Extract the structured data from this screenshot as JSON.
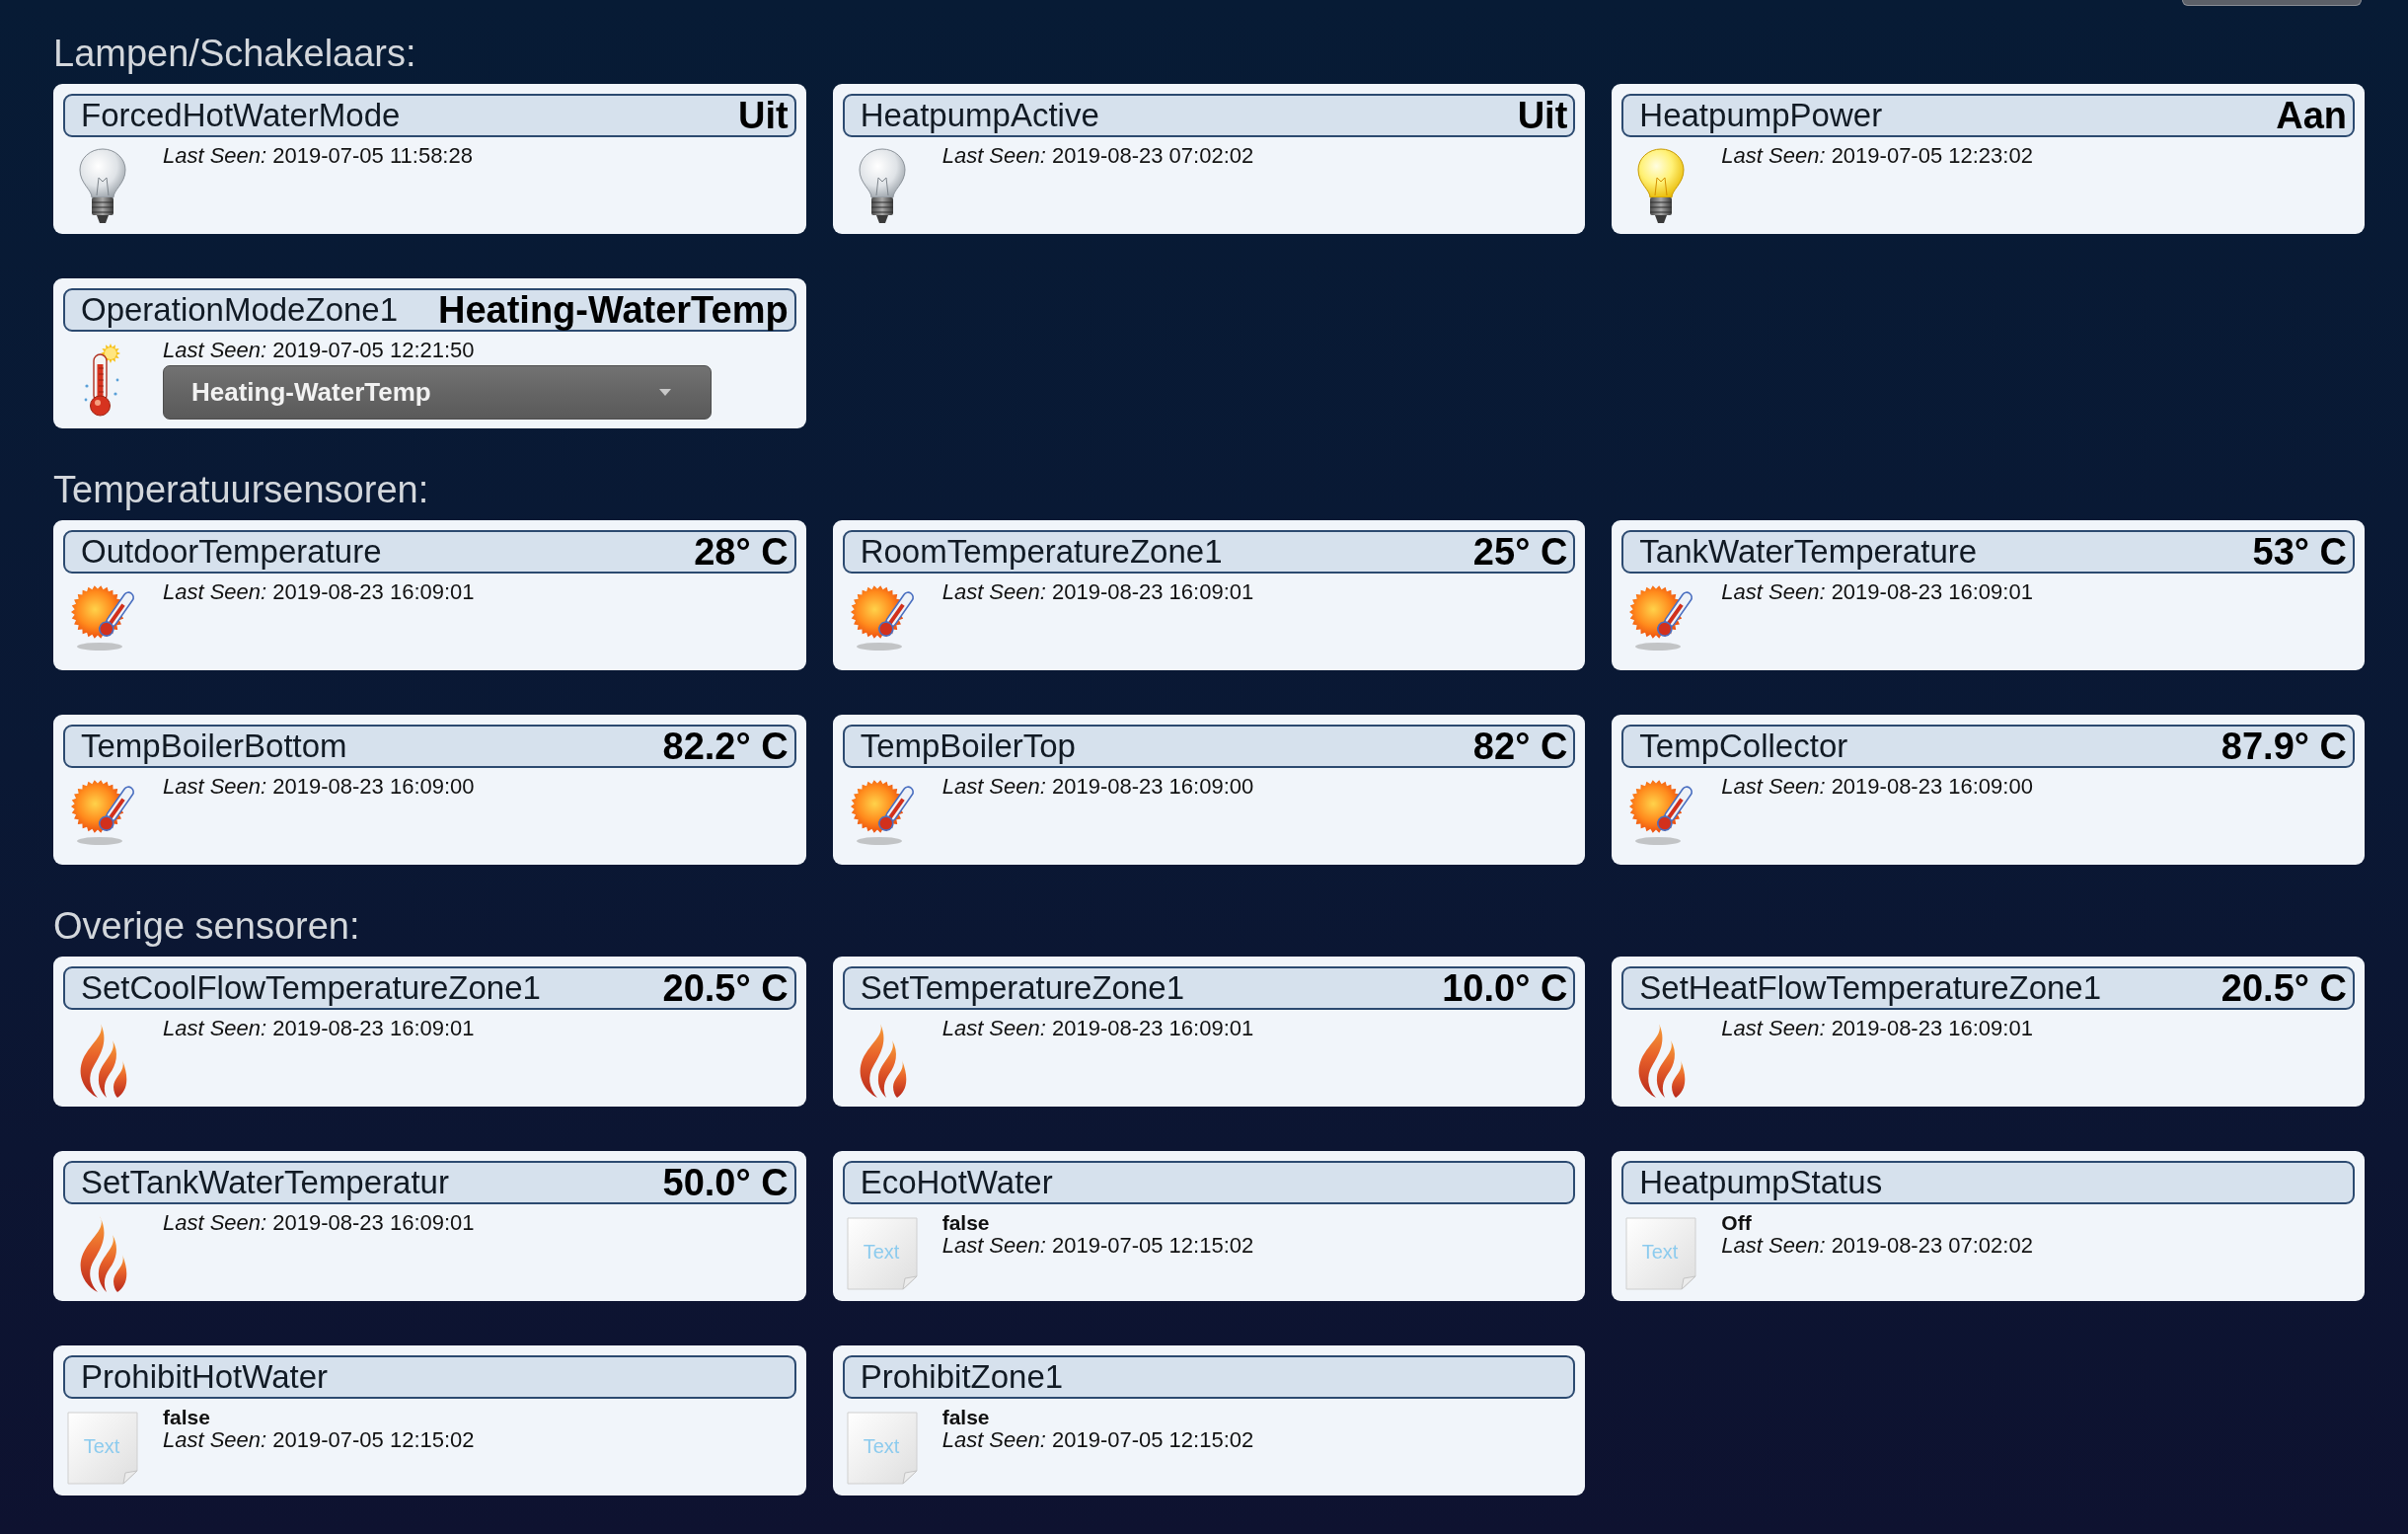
{
  "sections": [
    {
      "title": "Lampen/Schakelaars:",
      "devices": [
        {
          "kind": "switch",
          "name": "ForcedHotWaterMode",
          "value": "Uit",
          "on": false,
          "last_seen": "*Last Seen:* 2019-07-05 11:58:28"
        },
        {
          "kind": "switch",
          "name": "HeatpumpActive",
          "value": "Uit",
          "on": false,
          "last_seen": "*Last Seen:* 2019-08-23 07:02:02"
        },
        {
          "kind": "switch",
          "name": "HeatpumpPower",
          "value": "Aan",
          "on": true,
          "last_seen": "*Last Seen:* 2019-07-05 12:23:02"
        },
        {
          "kind": "selector",
          "name": "OperationModeZone1",
          "value": "Heating-WaterTemp",
          "last_seen": "*Last Seen:* 2019-07-05 12:21:50",
          "dropdown": {
            "value": "Heating-WaterTemp"
          }
        }
      ]
    },
    {
      "title": "Temperatuursensoren:",
      "devices": [
        {
          "kind": "temperature",
          "name": "OutdoorTemperature",
          "value": "28° C",
          "last_seen": "*Last Seen:* 2019-08-23 16:09:01"
        },
        {
          "kind": "temperature",
          "name": "RoomTemperatureZone1",
          "value": "25° C",
          "last_seen": "*Last Seen:* 2019-08-23 16:09:01"
        },
        {
          "kind": "temperature",
          "name": "TankWaterTemperature",
          "value": "53° C",
          "last_seen": "*Last Seen:* 2019-08-23 16:09:01"
        },
        {
          "kind": "temperature",
          "name": "TempBoilerBottom",
          "value": "82.2° C",
          "last_seen": "*Last Seen:* 2019-08-23 16:09:00"
        },
        {
          "kind": "temperature",
          "name": "TempBoilerTop",
          "value": "82° C",
          "last_seen": "*Last Seen:* 2019-08-23 16:09:00"
        },
        {
          "kind": "temperature",
          "name": "TempCollector",
          "value": "87.9° C",
          "last_seen": "*Last Seen:* 2019-08-23 16:09:00"
        }
      ]
    },
    {
      "title": "Overige sensoren:",
      "devices": [
        {
          "kind": "setpoint",
          "name": "SetCoolFlowTemperatureZone1",
          "value": "20.5° C",
          "last_seen": "*Last Seen:* 2019-08-23 16:09:01"
        },
        {
          "kind": "setpoint",
          "name": "SetTemperatureZone1",
          "value": "10.0° C",
          "last_seen": "*Last Seen:* 2019-08-23 16:09:01"
        },
        {
          "kind": "setpoint",
          "name": "SetHeatFlowTemperatureZone1",
          "value": "20.5° C",
          "last_seen": "*Last Seen:* 2019-08-23 16:09:01"
        },
        {
          "kind": "setpoint",
          "name": "SetTankWaterTemperatur",
          "value": "50.0° C",
          "last_seen": "*Last Seen:* 2019-08-23 16:09:01"
        },
        {
          "kind": "text",
          "name": "EcoHotWater",
          "icon_label": "Text",
          "status": "false",
          "last_seen": "*Last Seen:* 2019-07-05 12:15:02"
        },
        {
          "kind": "text",
          "name": "HeatpumpStatus",
          "icon_label": "Text",
          "status": "Off",
          "last_seen": "*Last Seen:* 2019-08-23 07:02:02"
        },
        {
          "kind": "text",
          "name": "ProhibitHotWater",
          "icon_label": "Text",
          "status": "false",
          "last_seen": "*Last Seen:* 2019-07-05 12:15:02"
        },
        {
          "kind": "text",
          "name": "ProhibitZone1",
          "icon_label": "Text",
          "status": "false",
          "last_seen": "*Last Seen:* 2019-07-05 12:15:02"
        }
      ]
    }
  ]
}
